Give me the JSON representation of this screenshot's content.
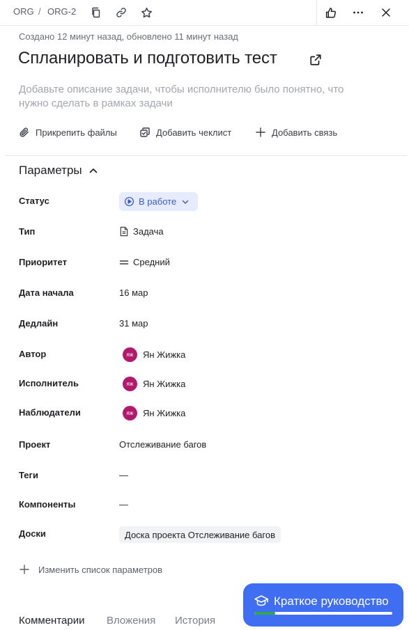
{
  "breadcrumb": {
    "project": "ORG",
    "separator": "/",
    "issue_key": "ORG-2"
  },
  "meta": {
    "created_updated": "Создано 12 минут назад, обновлено 11 минут назад"
  },
  "task": {
    "title": "Спланировать и подготовить тест",
    "description_placeholder": "Добавьте описание задачи, чтобы исполнителю было понятно, что нужно сделать в рамках задачи"
  },
  "actions": {
    "attach": "Прикрепить файлы",
    "checklist": "Добавить чеклист",
    "link": "Добавить связь"
  },
  "params": {
    "header": "Параметры",
    "status": {
      "label": "Статус",
      "value": "В работе"
    },
    "type": {
      "label": "Тип",
      "value": "Задача"
    },
    "priority": {
      "label": "Приоритет",
      "value": "Средний"
    },
    "start_date": {
      "label": "Дата начала",
      "value": "16 мар"
    },
    "deadline": {
      "label": "Дедлайн",
      "value": "31 мар"
    },
    "author": {
      "label": "Автор",
      "initials": "ЯЖ",
      "name": "Ян Жижка"
    },
    "assignee": {
      "label": "Исполнитель",
      "initials": "ЯЖ",
      "name": "Ян Жижка"
    },
    "watchers": {
      "label": "Наблюдатели",
      "initials": "ЯЖ",
      "name": "Ян Жижка"
    },
    "project": {
      "label": "Проект",
      "value": "Отслеживание багов"
    },
    "tags": {
      "label": "Теги",
      "value": "—"
    },
    "components": {
      "label": "Компоненты",
      "value": "—"
    },
    "boards": {
      "label": "Доски",
      "value": "Доска проекта Отслеживание багов"
    }
  },
  "edit_params": "Изменить список параметров",
  "tabs": [
    "Комментарии",
    "Вложения",
    "История"
  ],
  "guide": {
    "label": "Краткое руководство",
    "progress": 0.15
  },
  "colors": {
    "accent": "#3f6ef2",
    "status_bg": "#e6ecfd",
    "status_text": "#3e5cc9",
    "avatar": "#b2186b",
    "progress": "#2fa84f"
  }
}
